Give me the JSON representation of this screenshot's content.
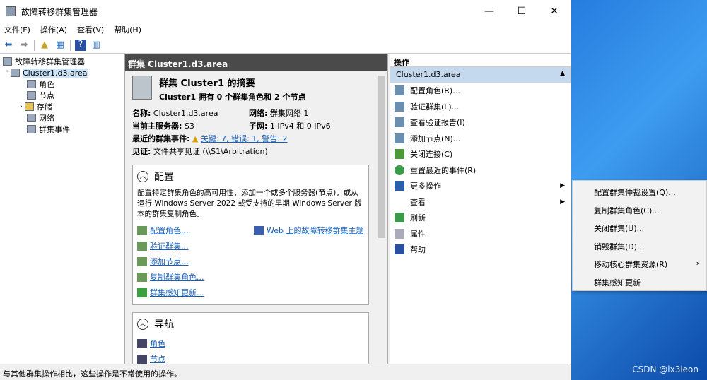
{
  "window": {
    "title": "故障转移群集管理器",
    "min": "—",
    "max": "☐",
    "close": "✕"
  },
  "menu": [
    "文件(F)",
    "操作(A)",
    "查看(V)",
    "帮助(H)"
  ],
  "tree": [
    {
      "label": "故障转移群集管理器"
    },
    {
      "label": "Cluster1.d3.area"
    },
    {
      "label": "角色"
    },
    {
      "label": "节点"
    },
    {
      "label": "存储"
    },
    {
      "label": "网络"
    },
    {
      "label": "群集事件"
    }
  ],
  "center": {
    "header": "群集 Cluster1.d3.area",
    "title": "群集 Cluster1 的摘要",
    "subtitle": "Cluster1 拥有 0 个群集角色和 2 个节点",
    "name_k": "名称:",
    "name_v": "Cluster1.d3.area",
    "net_k": "网络:",
    "net_v": "群集网络 1",
    "host_k": "当前主服务器:",
    "host_v": "S3",
    "subnet_k": "子网:",
    "subnet_v": "1 IPv4 和 0 IPv6",
    "events_k": "最近的群集事件:",
    "events_v": "关键: 7, 错误: 1, 警告: 2",
    "witness_k": "见证:",
    "witness_v": "文件共享见证 (\\\\S1\\Arbitration)",
    "config": {
      "title": "配置",
      "desc": "配置特定群集角色的高可用性，添加一个或多个服务器(节点)，或从运行 Windows Server 2022 或受支持的早期 Windows Server 版本的群集复制角色。",
      "links": [
        "配置角色...",
        "验证群集...",
        "添加节点...",
        "复制群集角色...",
        "群集感知更新..."
      ],
      "web": "Web 上的故障转移群集主题"
    },
    "nav": {
      "title": "导航",
      "links": [
        "角色",
        "节点"
      ]
    }
  },
  "actions": {
    "header": "操作",
    "sub": "Cluster1.d3.area",
    "items": [
      "配置角色(R)...",
      "验证群集(L)...",
      "查看验证报告(I)",
      "添加节点(N)...",
      "关闭连接(C)",
      "重置最近的事件(R)",
      "更多操作",
      "查看",
      "刷新",
      "属性",
      "帮助"
    ]
  },
  "context_menu": [
    "配置群集仲裁设置(Q)...",
    "复制群集角色(C)...",
    "关闭群集(U)...",
    "销毁群集(D)...",
    "移动核心群集资源(R)",
    "群集感知更新"
  ],
  "status": "与其他群集操作相比，这些操作是不常使用的操作。",
  "watermark": "CSDN @lx3leon"
}
